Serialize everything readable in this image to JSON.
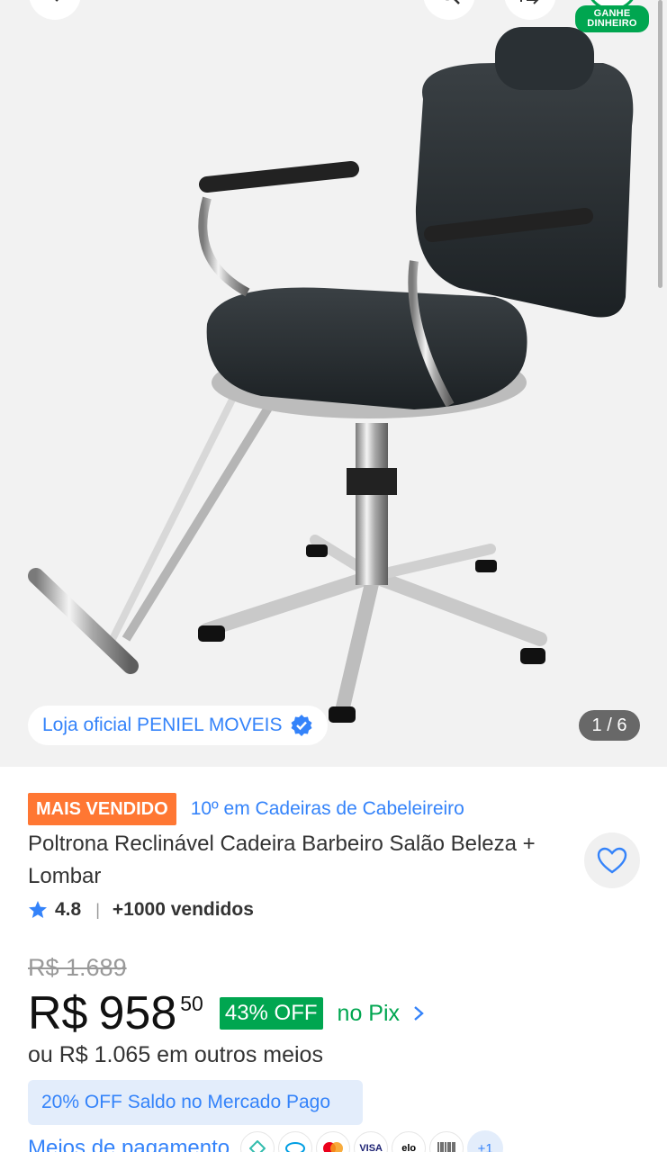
{
  "gallery": {
    "store_label": "Loja oficial PENIEL MOVEIS",
    "counter": "1 / 6",
    "earn_badge_line1": "GANHE",
    "earn_badge_line2": "DINHEIRO"
  },
  "product": {
    "best_seller_badge": "MAIS VENDIDO",
    "rank_text": "10º em Cadeiras de Cabeleireiro",
    "title": "Poltrona Reclinável Cadeira Barbeiro Salão Beleza + Lombar",
    "rating": "4.8",
    "separator": "|",
    "sold": "+1000 vendidos"
  },
  "pricing": {
    "old_price": "R$ 1.689",
    "currency": "R$",
    "amount": "958",
    "cents": "50",
    "discount": "43% OFF",
    "pix_label": "no Pix",
    "alt_price": "ou R$ 1.065 em outros meios",
    "promo": "20% OFF Saldo no Mercado Pago"
  },
  "payment": {
    "link_label": "Meios de pagamento",
    "more": "+1",
    "visa": "VISA",
    "elo": "elo"
  },
  "colors": {
    "accent_blue": "#3483fa",
    "success_green": "#00a650",
    "badge_orange": "#ff7733"
  }
}
